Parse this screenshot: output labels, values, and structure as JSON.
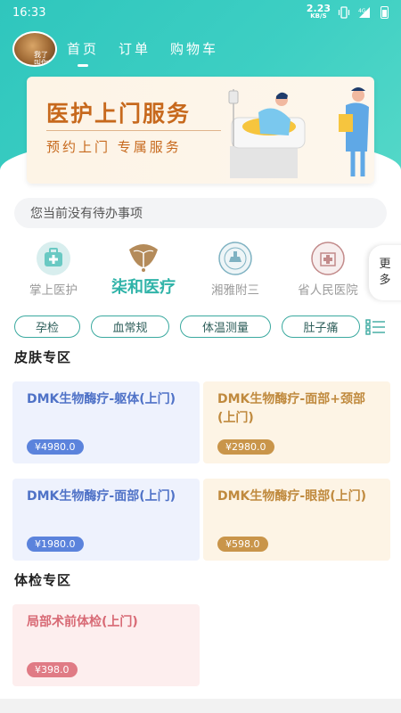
{
  "status_bar": {
    "time": "16:33",
    "net_speed": "2.23",
    "net_unit": "KB/S",
    "signal": "4G"
  },
  "avatar": {
    "caption_1": "我了",
    "caption_2": "叫你麻了"
  },
  "nav": {
    "tabs": [
      "首页",
      "订单",
      "购物车"
    ],
    "active": 0
  },
  "banner": {
    "title": "医护上门服务",
    "subtitle": "预约上门  专属服务"
  },
  "todo": {
    "text": "您当前没有待办事项"
  },
  "hospitals": [
    {
      "label": "掌上医护",
      "icon": "medical-kit-icon",
      "active": false
    },
    {
      "label": "柒和医疗",
      "icon": "ginkgo-logo-icon",
      "active": true
    },
    {
      "label": "湘雅附三",
      "icon": "xiangya-logo-icon",
      "active": false
    },
    {
      "label": "省人民医院",
      "icon": "provincial-hospital-logo-icon",
      "active": false
    }
  ],
  "more": {
    "line1": "更",
    "line2": "多"
  },
  "tags": [
    "孕检",
    "血常规",
    "体温测量",
    "肚子痛"
  ],
  "sections": {
    "skin": {
      "title": "皮肤专区",
      "items": [
        {
          "title": "DMK生物酶疗-躯体(上门)",
          "price": "¥4980.0",
          "color": "blue"
        },
        {
          "title": "DMK生物酶疗-面部+颈部(上门)",
          "price": "¥2980.0",
          "color": "gold"
        },
        {
          "title": "DMK生物酶疗-面部(上门)",
          "price": "¥1980.0",
          "color": "blue"
        },
        {
          "title": "DMK生物酶疗-眼部(上门)",
          "price": "¥598.0",
          "color": "gold"
        }
      ]
    },
    "checkup": {
      "title": "体检专区",
      "items": [
        {
          "title": "局部术前体检(上门)",
          "price": "¥398.0",
          "color": "pink"
        }
      ]
    }
  },
  "colors": {
    "primary": "#2fc6bd",
    "accent_orange": "#c7691d",
    "blue_card": "#eef2fd",
    "gold_card": "#fdf4e5",
    "pink_card": "#fdeeee"
  }
}
